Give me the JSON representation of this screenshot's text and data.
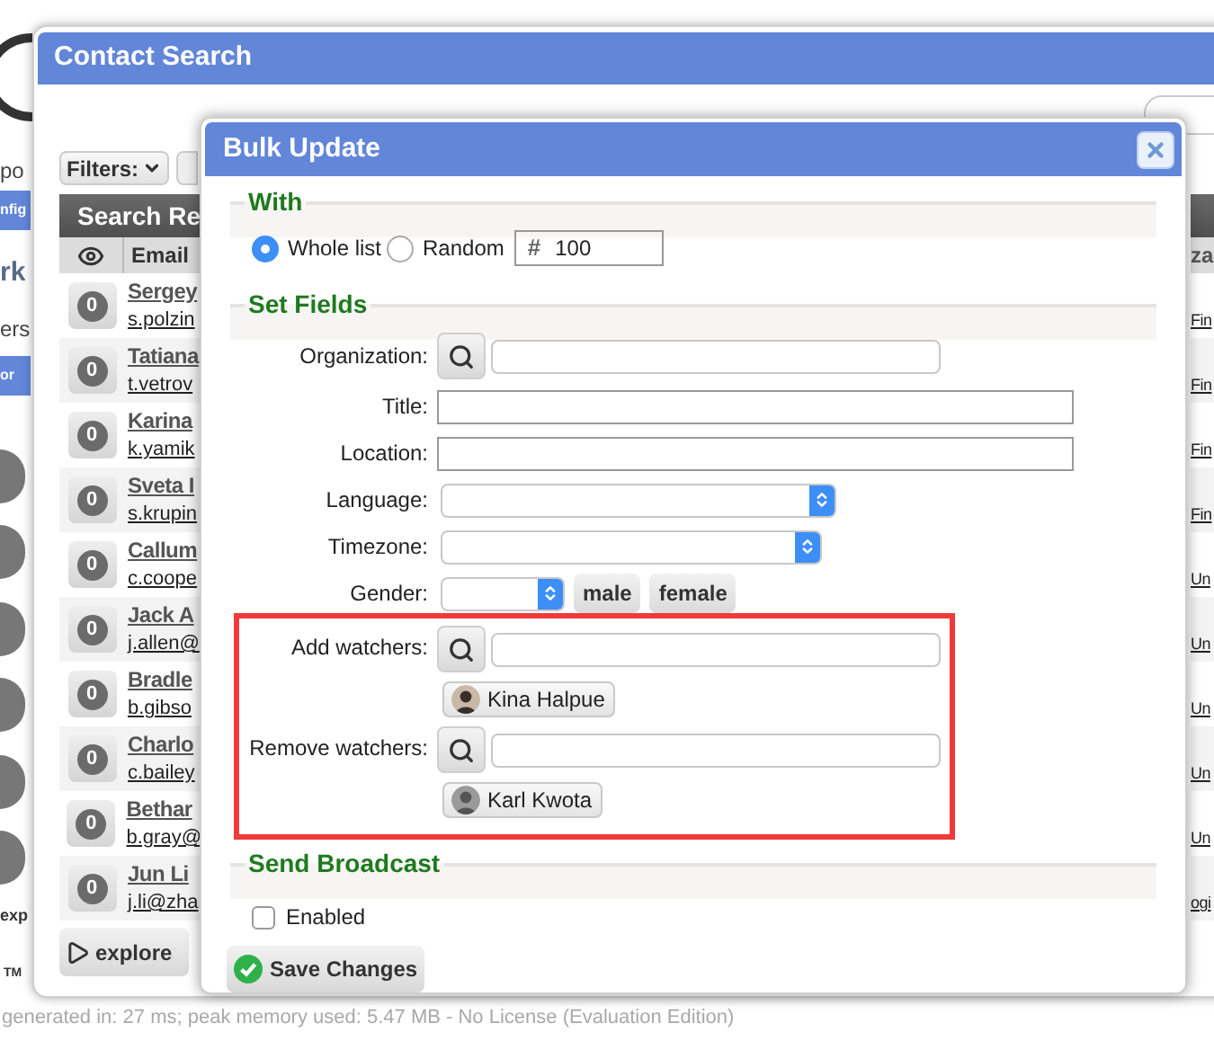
{
  "background_page": {
    "fragments": [
      {
        "kind": "text",
        "text": "po"
      },
      {
        "kind": "bar",
        "text": "nfig"
      },
      {
        "kind": "heading",
        "text": "rk"
      },
      {
        "kind": "text",
        "text": "ers"
      },
      {
        "kind": "bar",
        "text": "or"
      },
      {
        "kind": "button",
        "text": "exp"
      },
      {
        "kind": "mark",
        "text": "TM"
      }
    ]
  },
  "contact_search": {
    "title": "Contact Search",
    "filters_button": "Filters:",
    "results_header": "Search Re",
    "columns": [
      "Email"
    ],
    "right_column_header": "za",
    "rows": [
      {
        "count": "0",
        "name": "Sergey",
        "email": "s.polzin",
        "column_3": "Fin"
      },
      {
        "count": "0",
        "name": "Tatiana",
        "email": "t.vetrov",
        "column_3": "Fin"
      },
      {
        "count": "0",
        "name": "Karina",
        "email": "k.yamik",
        "column_3": "Fin"
      },
      {
        "count": "0",
        "name": "Sveta I",
        "email": "s.krupin",
        "column_3": "Fin"
      },
      {
        "count": "0",
        "name": "Callum",
        "email": "c.coope",
        "column_3": "Un"
      },
      {
        "count": "0",
        "name": "Jack A",
        "email": "j.allen@",
        "column_3": "Un"
      },
      {
        "count": "0",
        "name": "Bradle",
        "email": "b.gibso",
        "column_3": "Un"
      },
      {
        "count": "0",
        "name": "Charlo",
        "email": "c.bailey",
        "column_3": "Un"
      },
      {
        "count": "0",
        "name": "Bethar",
        "email": "b.gray@",
        "column_3": "Un"
      },
      {
        "count": "0",
        "name": "Jun Li",
        "email": "j.li@zha",
        "column_3": "ogi"
      }
    ],
    "explore_button": "explore"
  },
  "footer": "generated in: 27 ms; peak memory used: 5.47 MB - No License (Evaluation Edition)",
  "bulk_update": {
    "title": "Bulk Update",
    "with": {
      "heading": "With",
      "options": [
        {
          "label": "Whole list",
          "selected": true
        },
        {
          "label": "Random",
          "selected": false
        }
      ],
      "count_icon": "#",
      "count": "100"
    },
    "set_fields": {
      "heading": "Set Fields",
      "fields": [
        {
          "kind": "search",
          "label": "Organization:"
        },
        {
          "kind": "text",
          "label": "Title:"
        },
        {
          "kind": "text",
          "label": "Location:"
        },
        {
          "kind": "select",
          "label": "Language:"
        },
        {
          "kind": "select",
          "label": "Timezone:"
        },
        {
          "kind": "gender",
          "label": "Gender:",
          "buttons": [
            "male",
            "female"
          ]
        }
      ]
    },
    "watchers": {
      "highlighted": true,
      "groups": [
        {
          "label": "Add watchers:",
          "chips": [
            "Kina Halpue"
          ]
        },
        {
          "label": "Remove watchers:",
          "chips": [
            "Karl Kwota"
          ]
        }
      ]
    },
    "broadcast": {
      "heading": "Send Broadcast",
      "checkbox": {
        "label": "Enabled",
        "checked": false
      }
    },
    "save_button": "Save Changes"
  }
}
